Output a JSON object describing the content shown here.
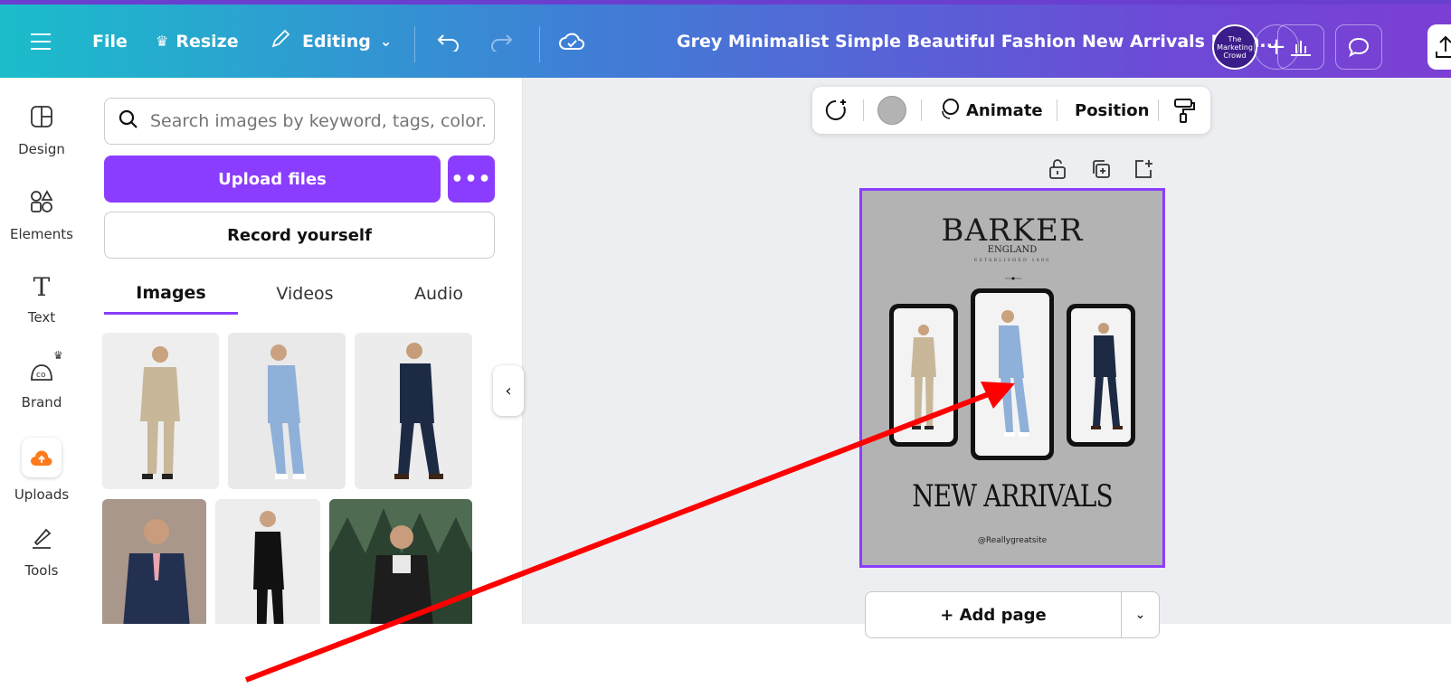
{
  "topbar": {
    "file_label": "File",
    "resize_label": "Resize",
    "editing_label": "Editing",
    "document_title": "Grey Minimalist Simple Beautiful Fashion New Arrivals Insta...",
    "avatar_text": "The Marketing Crowd"
  },
  "rail": {
    "items": [
      {
        "label": "Design",
        "icon": "design-icon"
      },
      {
        "label": "Elements",
        "icon": "elements-icon"
      },
      {
        "label": "Text",
        "icon": "text-icon"
      },
      {
        "label": "Brand",
        "icon": "brand-icon"
      },
      {
        "label": "Uploads",
        "icon": "upload-cloud-icon"
      },
      {
        "label": "Tools",
        "icon": "tools-icon"
      }
    ]
  },
  "panel": {
    "search_placeholder": "Search images by keyword, tags, color...",
    "upload_label": "Upload files",
    "more_label": "•••",
    "record_label": "Record yourself",
    "tabs": [
      {
        "label": "Images",
        "active": true
      },
      {
        "label": "Videos",
        "active": false
      },
      {
        "label": "Audio",
        "active": false
      }
    ],
    "collapse_label": "‹"
  },
  "context_toolbar": {
    "animate_label": "Animate",
    "position_label": "Position"
  },
  "design": {
    "brand": "BARKER",
    "brand_sub": "ENGLAND",
    "established": "ESTABLISHED 1880",
    "headline": "NEW ARRIVALS",
    "handle": "@Reallygreatsite"
  },
  "add_page_label": "+ Add page",
  "colors": {
    "accent": "#8b3dff",
    "canvas_bg": "#eceef1",
    "page_bg": "#b3b3b3",
    "annotation_arrow": "#ff0000"
  }
}
